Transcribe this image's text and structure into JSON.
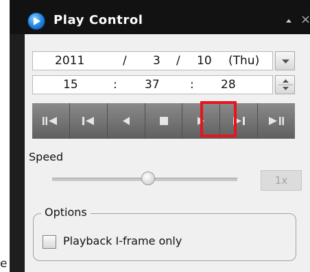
{
  "window": {
    "title": "Play Control",
    "collapse_icon": "triangle-up-icon",
    "close_glyph": "×"
  },
  "stray_text": "e",
  "date": {
    "year": "2011",
    "sep1": "/",
    "month": "3",
    "sep2": "/",
    "day": "10",
    "weekday": "(Thu)",
    "dropdown_icon": "chevron-down-icon"
  },
  "time": {
    "hour": "15",
    "sep1": ":",
    "minute": "37",
    "sep2": ":",
    "second": "28",
    "spinner_icon": "spin-up-down-icon"
  },
  "transport": {
    "buttons": [
      {
        "name": "skip-to-start",
        "icon": "pause-rewind-icon"
      },
      {
        "name": "previous",
        "icon": "skip-back-icon"
      },
      {
        "name": "reverse-play",
        "icon": "play-reverse-icon"
      },
      {
        "name": "stop",
        "icon": "stop-icon"
      },
      {
        "name": "play",
        "icon": "play-icon",
        "highlighted": true
      },
      {
        "name": "next",
        "icon": "skip-forward-icon"
      },
      {
        "name": "skip-to-end",
        "icon": "play-pause-icon"
      }
    ],
    "highlight_color": "#e8141d"
  },
  "speed": {
    "label": "Speed",
    "value_label": "1x",
    "slider_position": 0.5
  },
  "options": {
    "group_label": "Options",
    "checkbox_label": "Playback I-frame only",
    "checked": false
  },
  "colors": {
    "titlebar": "#121212",
    "panel": "#f0f0f0",
    "transport": "#6e6e6e",
    "icon_blue": "#2a8ee6"
  }
}
